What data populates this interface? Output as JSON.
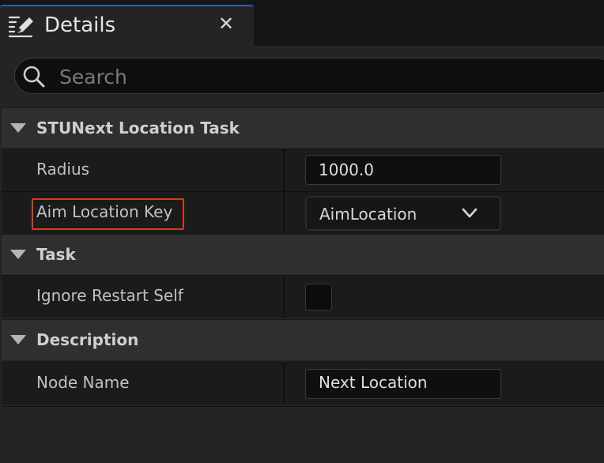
{
  "tab": {
    "title": "Details",
    "icon": "edit-list-icon",
    "close_glyph": "✕"
  },
  "search": {
    "placeholder": "Search",
    "value": ""
  },
  "sections": [
    {
      "label": "STUNext Location Task",
      "rows": [
        {
          "label": "Radius",
          "value": "1000.0",
          "type": "number"
        },
        {
          "label": "Aim Location Key",
          "value": "AimLocation",
          "type": "dropdown"
        }
      ]
    },
    {
      "label": "Task",
      "rows": [
        {
          "label": "Ignore Restart Self",
          "checked": false,
          "type": "checkbox"
        }
      ]
    },
    {
      "label": "Description",
      "rows": [
        {
          "label": "Node Name",
          "value": "Next Location",
          "type": "text"
        }
      ]
    }
  ],
  "colors": {
    "highlight": "#d2401f",
    "tab_accent": "#2f5fb3"
  }
}
